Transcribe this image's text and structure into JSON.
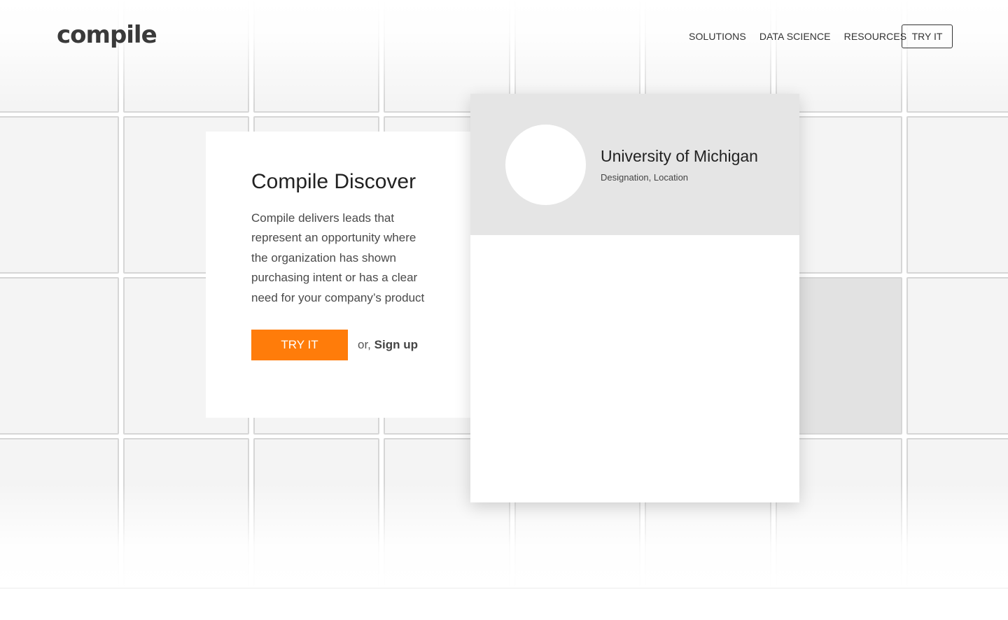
{
  "header": {
    "logo_text": "compile",
    "nav": [
      {
        "label": "SOLUTIONS"
      },
      {
        "label": "DATA SCIENCE"
      },
      {
        "label": "RESOURCES"
      }
    ],
    "try_label": "TRY IT"
  },
  "hero": {
    "title": "Compile Discover",
    "description": "Compile delivers leads that represent an opportunity where the organization has shown purchasing intent or has a clear need for your company’s product",
    "try_label": "TRY IT",
    "or_text": "or,",
    "signup_label": "Sign up"
  },
  "profile": {
    "name": "University of Michigan",
    "subtitle": "Designation, Location"
  },
  "colors": {
    "accent": "#ff7c0a",
    "profile_header": "#e5e5e5",
    "tile_bg": "#f4f4f4",
    "tile_border": "#d6d6d6"
  }
}
